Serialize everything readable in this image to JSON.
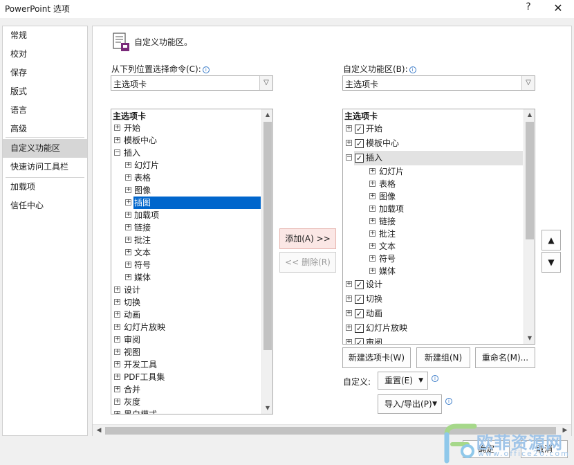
{
  "window": {
    "title": "PowerPoint 选项",
    "help": "?",
    "close": "✕"
  },
  "nav": {
    "items": [
      {
        "label": "常规"
      },
      {
        "label": "校对"
      },
      {
        "label": "保存"
      },
      {
        "label": "版式"
      },
      {
        "label": "语言"
      },
      {
        "label": "高级"
      },
      {
        "label": "自定义功能区",
        "active": true
      },
      {
        "label": "快速访问工具栏"
      },
      {
        "label": "加载项"
      },
      {
        "label": "信任中心"
      }
    ]
  },
  "main": {
    "header": "自定义功能区。",
    "left": {
      "label": "从下列位置选择命令(C):",
      "combo_value": "主选项卡",
      "tree_header": "主选项卡",
      "rows": [
        {
          "label": "开始",
          "level": 0,
          "exp": "+"
        },
        {
          "label": "模板中心",
          "level": 0,
          "exp": "+"
        },
        {
          "label": "插入",
          "level": 0,
          "exp": "−"
        },
        {
          "label": "幻灯片",
          "level": 1,
          "exp": "+"
        },
        {
          "label": "表格",
          "level": 1,
          "exp": "+"
        },
        {
          "label": "图像",
          "level": 1,
          "exp": "+"
        },
        {
          "label": "插图",
          "level": 1,
          "exp": "+",
          "selected": true
        },
        {
          "label": "加载项",
          "level": 1,
          "exp": "+"
        },
        {
          "label": "链接",
          "level": 1,
          "exp": "+"
        },
        {
          "label": "批注",
          "level": 1,
          "exp": "+"
        },
        {
          "label": "文本",
          "level": 1,
          "exp": "+"
        },
        {
          "label": "符号",
          "level": 1,
          "exp": "+"
        },
        {
          "label": "媒体",
          "level": 1,
          "exp": "+"
        },
        {
          "label": "设计",
          "level": 0,
          "exp": "+"
        },
        {
          "label": "切换",
          "level": 0,
          "exp": "+"
        },
        {
          "label": "动画",
          "level": 0,
          "exp": "+"
        },
        {
          "label": "幻灯片放映",
          "level": 0,
          "exp": "+"
        },
        {
          "label": "审阅",
          "level": 0,
          "exp": "+"
        },
        {
          "label": "视图",
          "level": 0,
          "exp": "+"
        },
        {
          "label": "开发工具",
          "level": 0,
          "exp": "+"
        },
        {
          "label": "PDF工具集",
          "level": 0,
          "exp": "+"
        },
        {
          "label": "合并",
          "level": 0,
          "exp": "+"
        },
        {
          "label": "灰度",
          "level": 0,
          "exp": "+"
        },
        {
          "label": "黑白模式",
          "level": 0,
          "exp": "+"
        }
      ]
    },
    "add_button": "添加(A) >>",
    "remove_button": "<< 删除(R)",
    "right": {
      "label": "自定义功能区(B):",
      "combo_value": "主选项卡",
      "tree_header": "主选项卡",
      "rows": [
        {
          "label": "开始",
          "level": 0,
          "exp": "+",
          "checked": true
        },
        {
          "label": "模板中心",
          "level": 0,
          "exp": "+",
          "checked": true
        },
        {
          "label": "插入",
          "level": 0,
          "exp": "−",
          "checked": true,
          "highlight": true
        },
        {
          "label": "幻灯片",
          "level": 1,
          "exp": "+"
        },
        {
          "label": "表格",
          "level": 1,
          "exp": "+"
        },
        {
          "label": "图像",
          "level": 1,
          "exp": "+"
        },
        {
          "label": "加载项",
          "level": 1,
          "exp": "+"
        },
        {
          "label": "链接",
          "level": 1,
          "exp": "+"
        },
        {
          "label": "批注",
          "level": 1,
          "exp": "+"
        },
        {
          "label": "文本",
          "level": 1,
          "exp": "+"
        },
        {
          "label": "符号",
          "level": 1,
          "exp": "+"
        },
        {
          "label": "媒体",
          "level": 1,
          "exp": "+"
        },
        {
          "label": "设计",
          "level": 0,
          "exp": "+",
          "checked": true
        },
        {
          "label": "切换",
          "level": 0,
          "exp": "+",
          "checked": true
        },
        {
          "label": "动画",
          "level": 0,
          "exp": "+",
          "checked": true
        },
        {
          "label": "幻灯片放映",
          "level": 0,
          "exp": "+",
          "checked": true
        },
        {
          "label": "审阅",
          "level": 0,
          "exp": "+",
          "checked": true
        }
      ]
    },
    "new_tab_button": "新建选项卡(W)",
    "new_group_button": "新建组(N)",
    "rename_button": "重命名(M)...",
    "customize_label": "自定义:",
    "reset_button": "重置(E)",
    "import_export_button": "导入/导出(P)",
    "move_up": "▲",
    "move_down": "▼"
  },
  "footer": {
    "ok": "确定",
    "cancel": "取消"
  },
  "watermark": {
    "text": "欧菲资源网",
    "url": "www.office26.com"
  }
}
